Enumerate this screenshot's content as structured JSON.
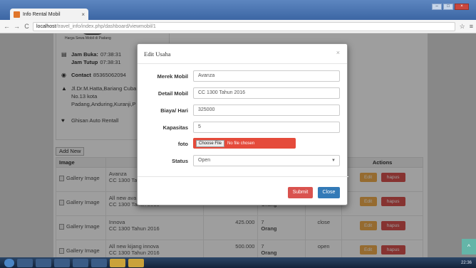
{
  "browser": {
    "tab_title": "Info Rental Mobil",
    "tab_close": "×",
    "url_host": "localhost",
    "url_path": "/travel_info/index.php/dashboard/viewmobil/1",
    "window_controls": [
      "–",
      "□",
      "×"
    ],
    "nav": {
      "back": "←",
      "forward": "→",
      "reload": "C"
    },
    "star": "☆",
    "menu": "≡"
  },
  "profile": {
    "logo_caption": "Harga Sewa Mobil di Padang",
    "jam_buka_label": "Jam Buka:",
    "jam_buka_value": "07:38:31",
    "jam_tutup_label": "Jam Tutup",
    "jam_tutup_value": "07:38:31",
    "contact_label": "Contact",
    "contact_value": "85365062094",
    "address_line1": "Jl.Dr.M.Hatta,Bariang Cuba",
    "address_line2": "No.13 kota",
    "address_line3": "Padang,Anduring,Kuranji,P",
    "owner": "Ghisan Auto Rentall",
    "icons": {
      "clock": "clock-icon",
      "eye": "eye-icon",
      "map": "map-marker-icon",
      "heart": "heart-icon"
    }
  },
  "table": {
    "add_new_label": "Add New",
    "headers": {
      "image": "Image",
      "actions": "Actions"
    },
    "rows": [
      {
        "image_alt": "Gallery Image",
        "name": "Avanza",
        "detail": "CC 1300 Ta",
        "price": "",
        "capacity": "",
        "unit": "",
        "status": "",
        "edit": "Edit",
        "hapus": "hapus"
      },
      {
        "image_alt": "Gallery Image",
        "name": "All new ava",
        "detail": "CC 1300 Tahun 2016",
        "price": "",
        "capacity": "",
        "unit": "Orang",
        "status": "",
        "edit": "Edit",
        "hapus": "hapus"
      },
      {
        "image_alt": "Gallery Image",
        "name": "Innova",
        "detail": "CC 1300 Tahun 2016",
        "price": "425.000",
        "capacity": "7",
        "unit": "Orang",
        "status": "close",
        "edit": "Edit",
        "hapus": "hapus"
      },
      {
        "image_alt": "Gallery Image",
        "name": "All new kijang innova",
        "detail": "CC 1300 Tahun 2016",
        "price": "500.000",
        "capacity": "7",
        "unit": "Orang",
        "status": "open",
        "edit": "Edit",
        "hapus": "hapus"
      }
    ]
  },
  "modal": {
    "title": "Edit Usaha",
    "close": "×",
    "fields": {
      "merek_label": "Merek Mobil",
      "merek_value": "Avanza",
      "detail_label": "Detail Mobil",
      "detail_value": "CC 1300 Tahun 2016",
      "biaya_label": "Biaya/ Hari",
      "biaya_value": "325000",
      "kapasitas_label": "Kapasitas",
      "kapasitas_value": "5",
      "foto_label": "foto",
      "choose_file": "Choose File",
      "no_file": "No file chosen",
      "status_label": "Status",
      "status_value": "Open"
    },
    "submit_label": "Submit",
    "close_label": "Close"
  },
  "scroll_top": "^",
  "taskbar": {
    "tray_text": "22:36"
  },
  "colors": {
    "submit": "#d9534f",
    "close": "#337ab7",
    "edit": "#f0ad4e",
    "hapus": "#d9534f",
    "file_field": "#e54b3b"
  }
}
